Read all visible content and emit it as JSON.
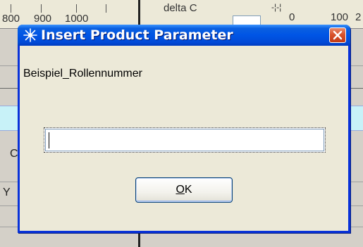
{
  "background": {
    "ruler_labels": [
      "800",
      "900",
      "1000"
    ],
    "column_header": "delta C",
    "axis_values": [
      "0",
      "100"
    ],
    "axis_suffix": "2",
    "left_letters": [
      "C",
      "Y"
    ]
  },
  "dialog": {
    "title": "Insert Product Parameter",
    "prompt": "Beispiel_Rollennummer",
    "input_value": "",
    "ok_label_mnemonic": "O",
    "ok_label_rest": "K"
  },
  "colors": {
    "titlebar": "#0055e5",
    "close_button": "#d9532c",
    "dialog_body": "#ece9d8"
  }
}
